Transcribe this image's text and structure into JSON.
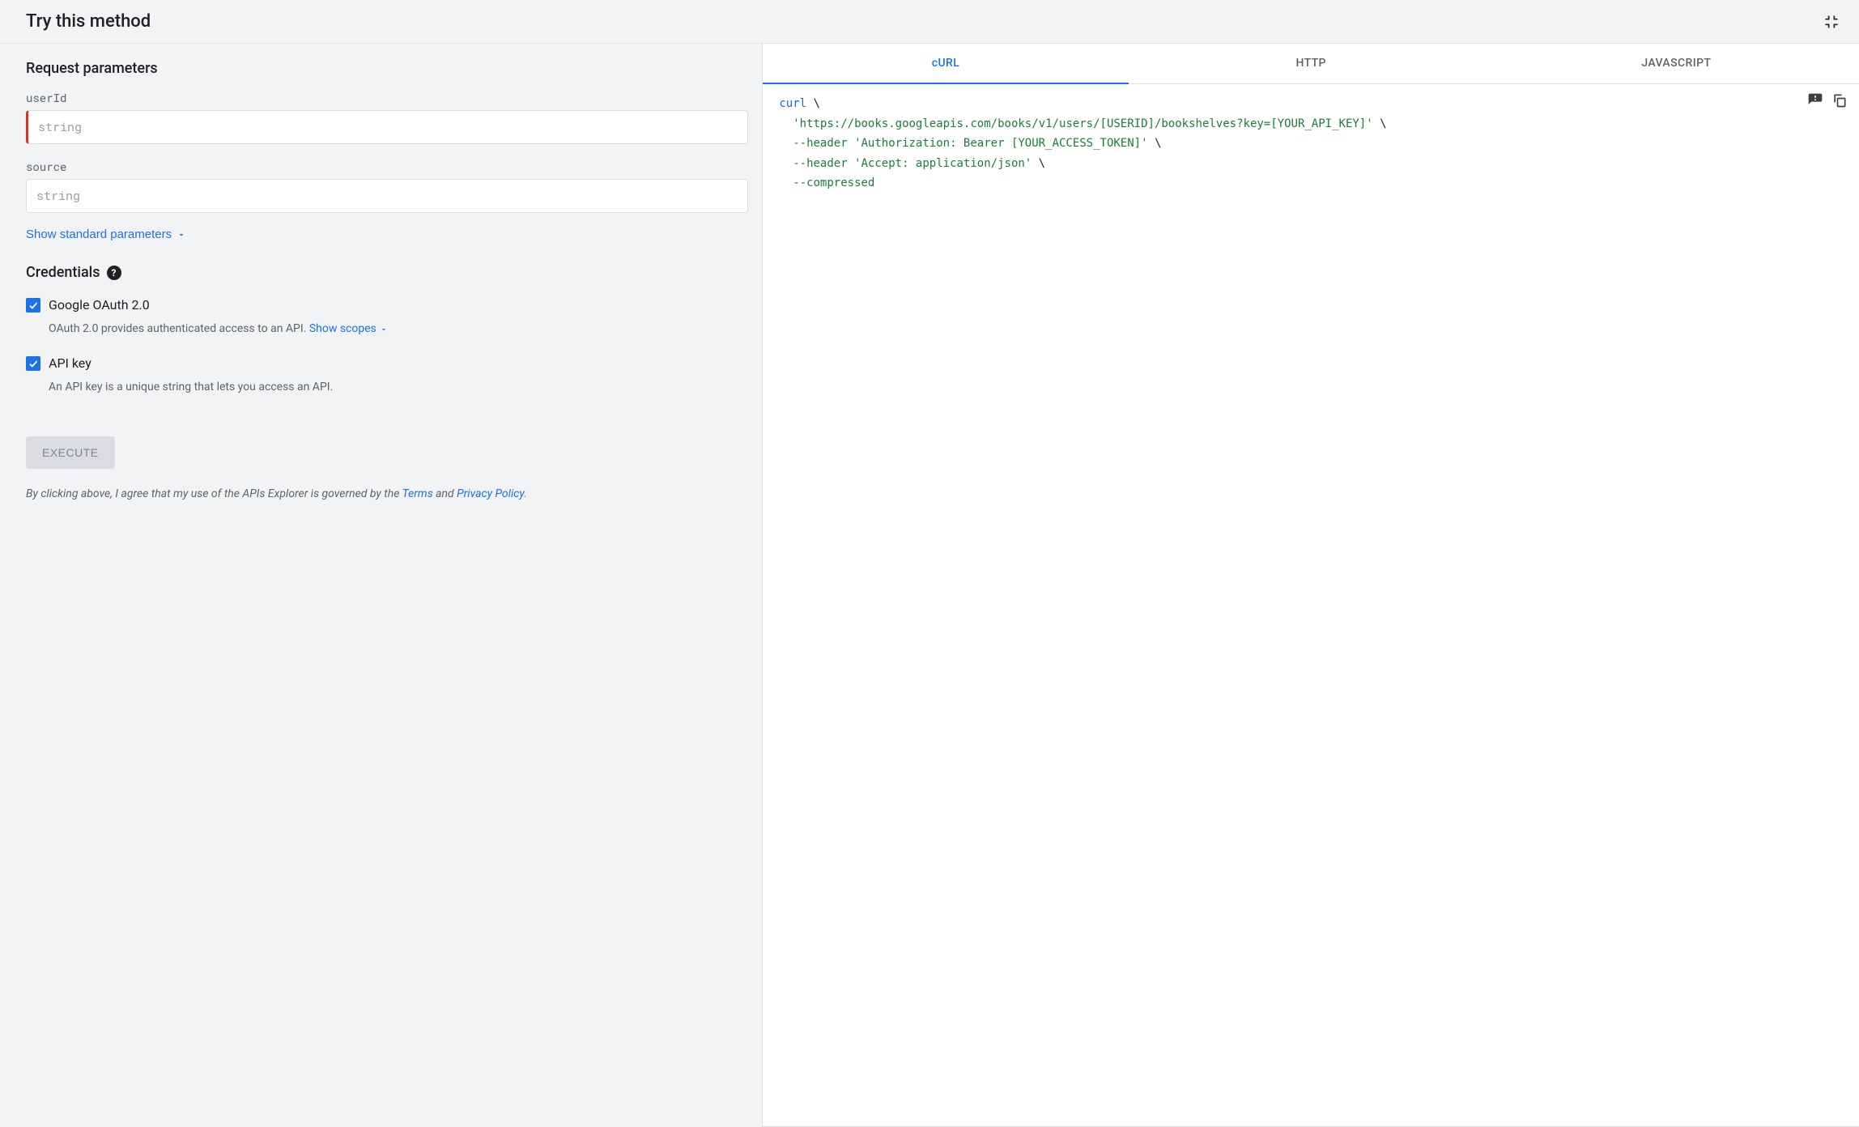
{
  "header": {
    "title": "Try this method"
  },
  "left": {
    "request_params_title": "Request parameters",
    "params": {
      "userId": {
        "label": "userId",
        "placeholder": "string",
        "value": "",
        "required": true
      },
      "source": {
        "label": "source",
        "placeholder": "string",
        "value": "",
        "required": false
      }
    },
    "show_standard_params": "Show standard parameters",
    "credentials_title": "Credentials",
    "credentials": {
      "oauth": {
        "label": "Google OAuth 2.0",
        "description_prefix": "OAuth 2.0 provides authenticated access to an API. ",
        "show_scopes": "Show scopes",
        "checked": true
      },
      "apikey": {
        "label": "API key",
        "description": "An API key is a unique string that lets you access an API.",
        "checked": true
      }
    },
    "execute": "EXECUTE",
    "disclaimer": {
      "prefix": "By clicking above, I agree that my use of the APIs Explorer is governed by the ",
      "terms": "Terms",
      "and": " and ",
      "privacy": "Privacy Policy",
      "suffix": "."
    }
  },
  "right": {
    "tabs": {
      "curl": "cURL",
      "http": "HTTP",
      "js": "JAVASCRIPT"
    },
    "active_tab": "curl",
    "code": {
      "line1": {
        "cmd": "curl",
        "tail": " \\"
      },
      "line2": {
        "str": "'https://books.googleapis.com/books/v1/users/[USERID]/bookshelves?key=[YOUR_API_KEY]'",
        "tail": " \\"
      },
      "line3": {
        "str": "--header 'Authorization: Bearer [YOUR_ACCESS_TOKEN]'",
        "tail": " \\"
      },
      "line4": {
        "str": "--header 'Accept: application/json'",
        "tail": " \\"
      },
      "line5": {
        "str": "--compressed"
      }
    }
  }
}
